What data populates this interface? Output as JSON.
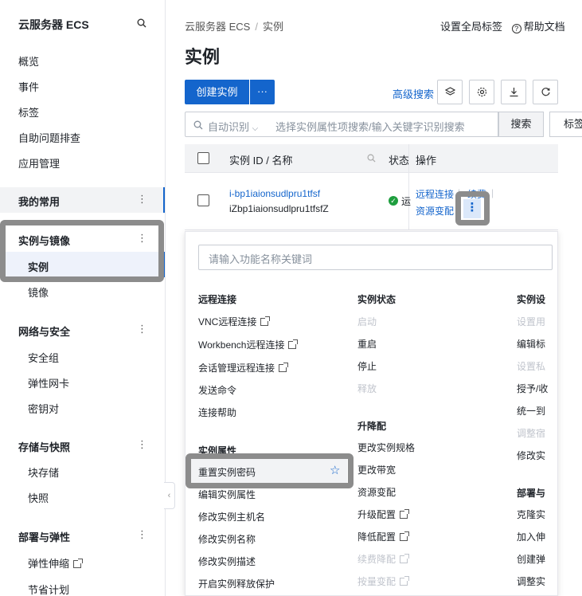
{
  "sidebar": {
    "title": "云服务器 ECS",
    "items": [
      "概览",
      "事件",
      "标签",
      "自助问题排查",
      "应用管理"
    ],
    "favorites": "我的常用",
    "groups": [
      {
        "label": "实例与镜像",
        "subs": [
          "实例",
          "镜像"
        ]
      },
      {
        "label": "网络与安全",
        "subs": [
          "安全组",
          "弹性网卡",
          "密钥对"
        ]
      },
      {
        "label": "存储与快照",
        "subs": [
          "块存储",
          "快照"
        ]
      },
      {
        "label": "部署与弹性",
        "subs": [
          "弹性伸缩",
          "节省计划"
        ]
      }
    ],
    "menu_glyph": "⋮"
  },
  "header": {
    "breadcrumb": [
      "云服务器 ECS",
      "实例"
    ],
    "breadcrumb_sep": "/",
    "global_tags": "设置全局标签",
    "help": "帮助文档",
    "title": "实例"
  },
  "toolbar": {
    "create": "创建实例",
    "more": "···",
    "advanced_search": "高级搜索"
  },
  "search": {
    "auto": "自动识别",
    "placeholder": "选择实例属性项搜索/输入关键字识别搜索",
    "button": "搜索",
    "tag_button": "标签"
  },
  "table": {
    "col_id": "实例 ID / 名称",
    "col_status": "状态",
    "col_ops": "操作",
    "row": {
      "id": "i-bp1iaionsudlpru1tfsf",
      "name": "iZbp1iaionsudlpru1tfsfZ",
      "status": "运",
      "ops": [
        "远程连接",
        "续费",
        "资源变配"
      ]
    }
  },
  "dropdown": {
    "search_placeholder": "请输入功能名称关键词",
    "col1": {
      "remote_title": "远程连接",
      "remote": [
        "VNC远程连接",
        "Workbench远程连接",
        "会话管理远程连接",
        "发送命令",
        "连接帮助"
      ],
      "attr_title": "实例属性",
      "attr": [
        "重置实例密码",
        "编辑实例属性",
        "修改实例主机名",
        "修改实例名称",
        "修改实例描述",
        "开启实例释放保护"
      ]
    },
    "col2": {
      "state_title": "实例状态",
      "state": [
        "启动",
        "重启",
        "停止",
        "释放"
      ],
      "upgrade_title": "升降配",
      "upgrade": [
        "更改实例规格",
        "更改带宽",
        "资源变配",
        "升级配置",
        "降低配置",
        "续费降配",
        "按量变配"
      ]
    },
    "col3": {
      "settings_title": "实例设",
      "settings": [
        "设置用",
        "编辑标",
        "设置私",
        "授予/收",
        "统一到",
        "调整宿",
        "修改实"
      ],
      "deploy_title": "部署与",
      "deploy": [
        "克隆实",
        "加入伸",
        "创建弹",
        "调整实"
      ]
    }
  }
}
